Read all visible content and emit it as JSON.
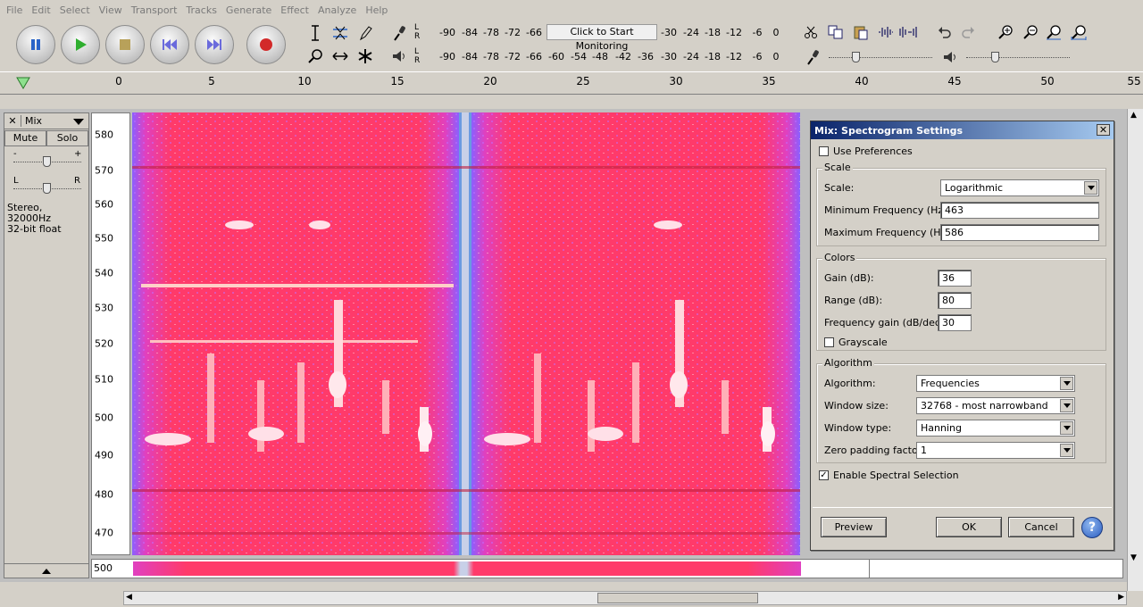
{
  "menu": [
    "File",
    "Edit",
    "Select",
    "View",
    "Transport",
    "Tracks",
    "Generate",
    "Effect",
    "Analyze",
    "Help"
  ],
  "meter": {
    "record_ticks": [
      "-90",
      "-84",
      "-78",
      "-72",
      "-66",
      "-30",
      "-24",
      "-18",
      "-12",
      "-6",
      "0"
    ],
    "monitor_label": "Click to Start Monitoring",
    "play_ticks": [
      "-90",
      "-84",
      "-78",
      "-72",
      "-66",
      "-60",
      "-54",
      "-48",
      "-42",
      "-36",
      "-30",
      "-24",
      "-18",
      "-12",
      "-6",
      "0"
    ],
    "lr": {
      "l": "L",
      "r": "R"
    }
  },
  "ruler": {
    "ticks": [
      "0",
      "5",
      "10",
      "15",
      "20",
      "25",
      "30",
      "35",
      "40",
      "45",
      "50",
      "55"
    ]
  },
  "track": {
    "name": "Mix",
    "mute_label": "Mute",
    "solo_label": "Solo",
    "gain_minus": "-",
    "gain_plus": "+",
    "pan_l": "L",
    "pan_r": "R",
    "info_line1": "Stereo, 32000Hz",
    "info_line2": "32-bit float"
  },
  "freq_scale": {
    "labels": [
      "580",
      "570",
      "560",
      "550",
      "540",
      "530",
      "520",
      "510",
      "500",
      "490",
      "480",
      "470"
    ]
  },
  "lower_clip_label": "500",
  "dialog": {
    "title": "Mix: Spectrogram Settings",
    "use_prefs": "Use Preferences",
    "scale_group": "Scale",
    "scale_label": "Scale:",
    "scale_value": "Logarithmic",
    "min_freq_label": "Minimum Frequency (Hz):",
    "min_freq_value": "463",
    "max_freq_label": "Maximum Frequency (Hz):",
    "max_freq_value": "586",
    "colors_group": "Colors",
    "gain_label": "Gain (dB):",
    "gain_value": "36",
    "range_label": "Range (dB):",
    "range_value": "80",
    "freq_gain_label": "Frequency gain (dB/dec):",
    "freq_gain_value": "30",
    "grayscale_label": "Grayscale",
    "algorithm_group": "Algorithm",
    "algorithm_label": "Algorithm:",
    "algorithm_value": "Frequencies",
    "window_size_label": "Window size:",
    "window_size_value": "32768 - most narrowband",
    "window_type_label": "Window type:",
    "window_type_value": "Hanning",
    "zero_pad_label": "Zero padding factor:",
    "zero_pad_value": "1",
    "spectral_sel_label": "Enable Spectral Selection",
    "preview_label": "Preview",
    "ok_label": "OK",
    "cancel_label": "Cancel",
    "help_label": "?"
  },
  "colors": {
    "accent": "#0a246a",
    "spectro_bg": "#ff4070",
    "spectro_hot": "#ffe0e8"
  }
}
